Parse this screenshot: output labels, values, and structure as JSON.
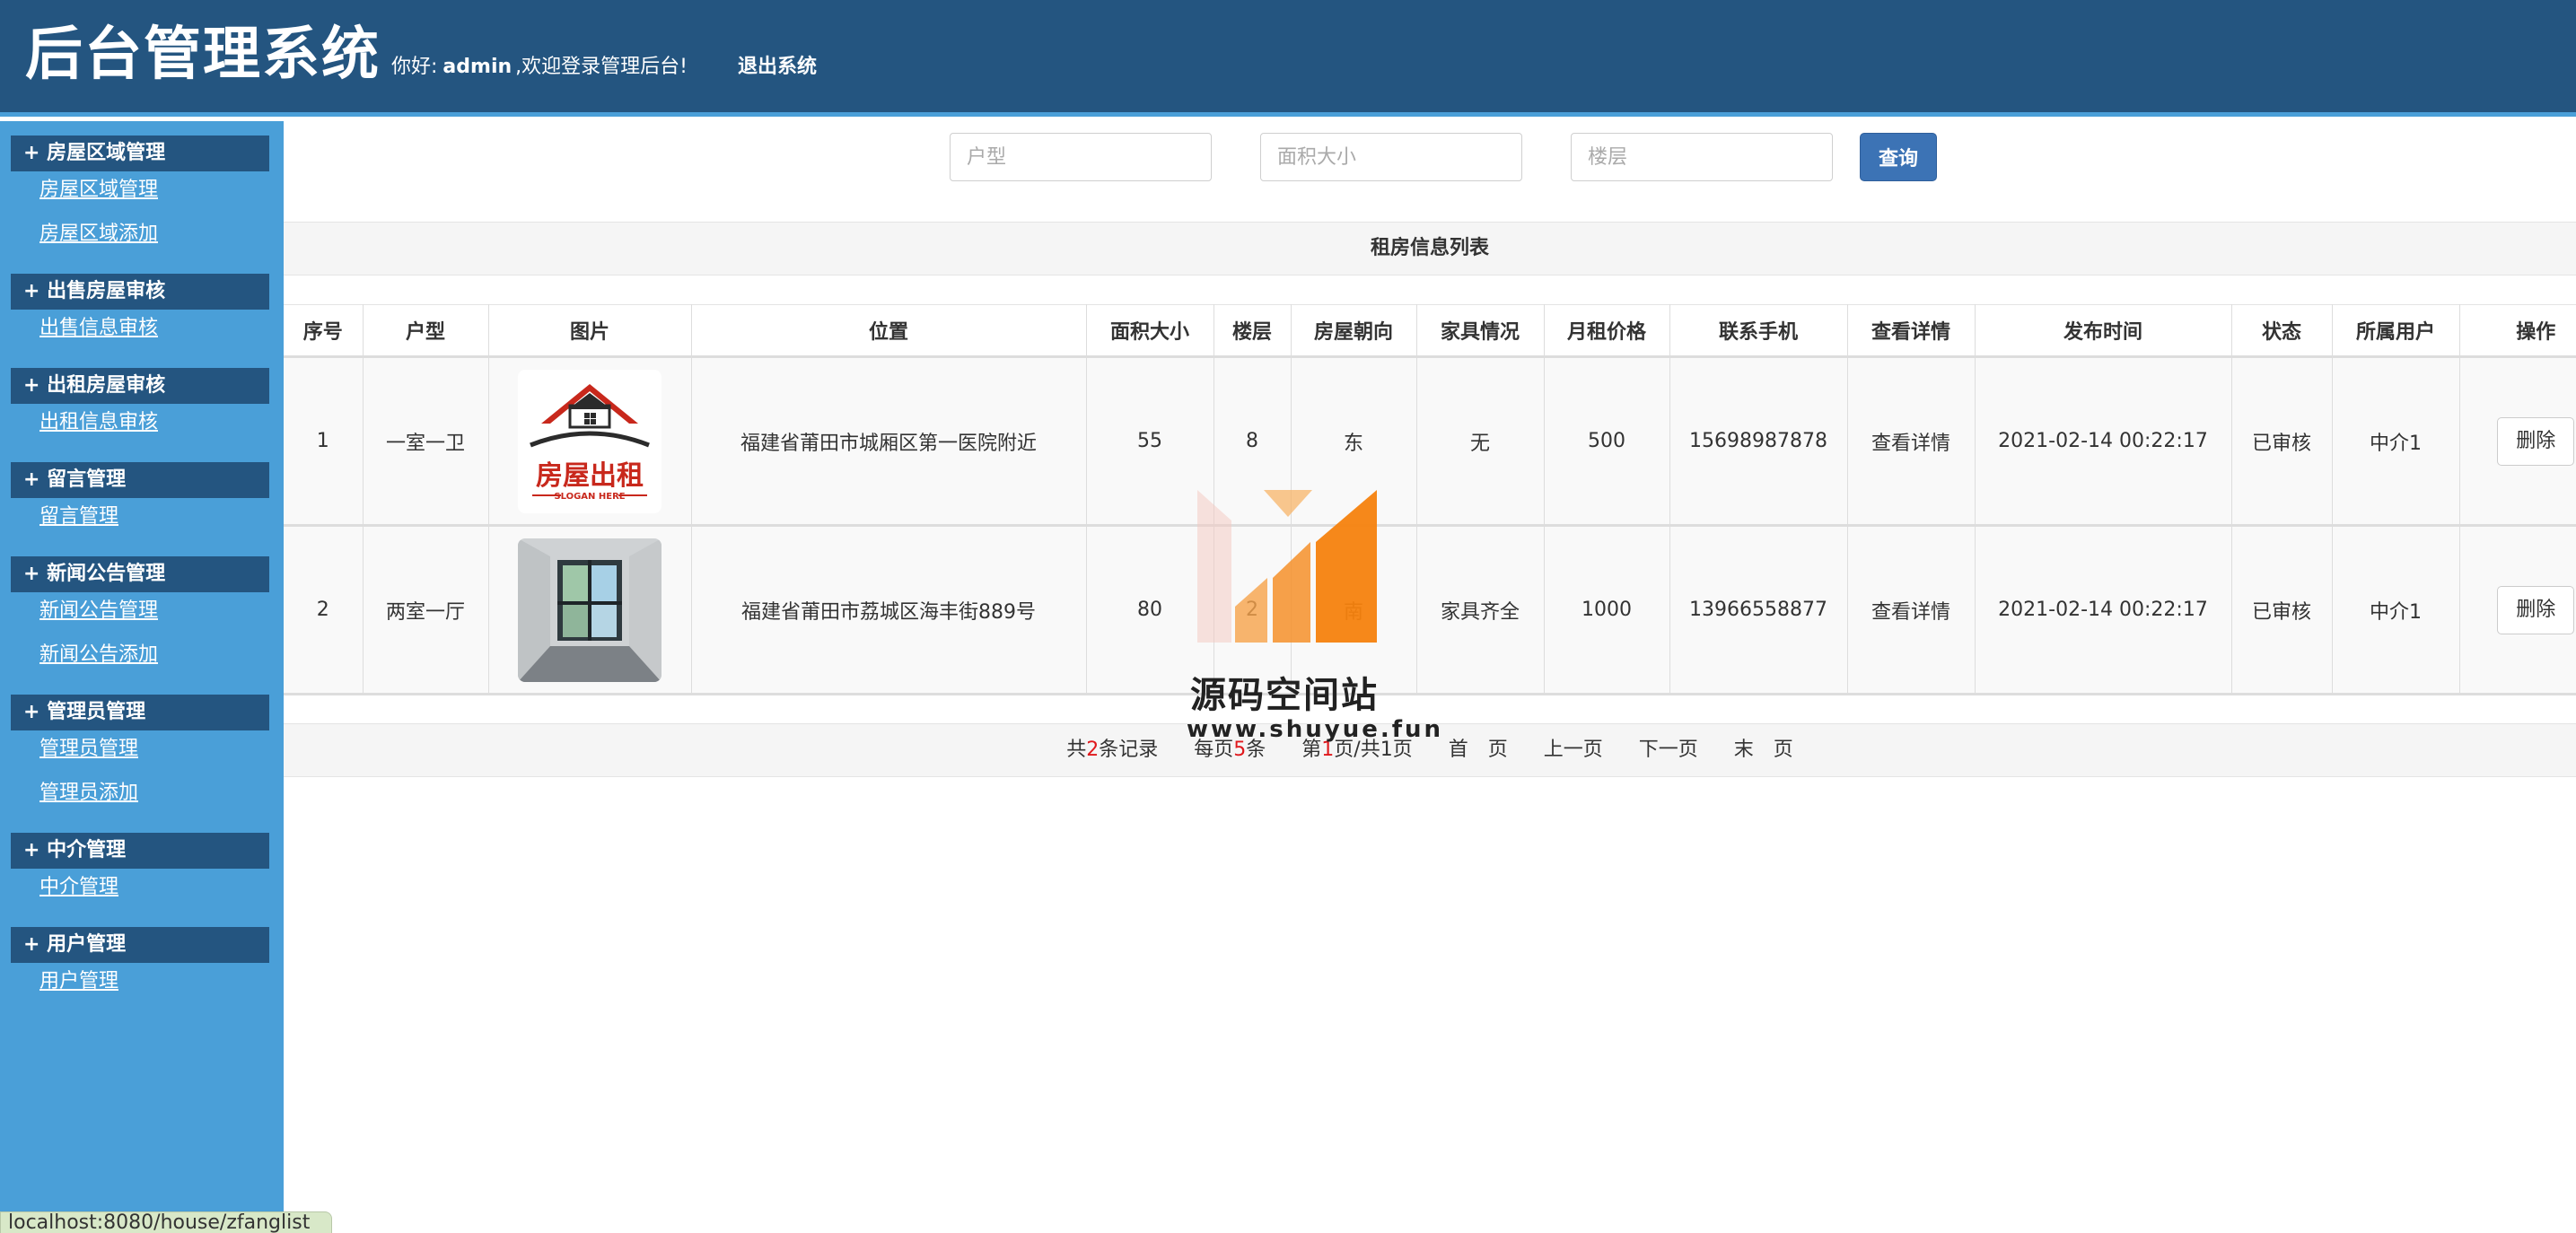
{
  "header": {
    "title": "后台管理系统",
    "greeting_prefix": "你好:",
    "username": "admin",
    "greeting_suffix": ",欢迎登录管理后台!",
    "logout_label": "退出系统"
  },
  "sidebar": {
    "groups": [
      {
        "title": "+ 房屋区域管理",
        "links": [
          "房屋区域管理",
          "房屋区域添加"
        ]
      },
      {
        "title": "+ 出售房屋审核",
        "links": [
          "出售信息审核"
        ]
      },
      {
        "title": "+ 出租房屋审核",
        "links": [
          "出租信息审核"
        ]
      },
      {
        "title": "+ 留言管理",
        "links": [
          "留言管理"
        ]
      },
      {
        "title": "+ 新闻公告管理",
        "links": [
          "新闻公告管理",
          "新闻公告添加"
        ]
      },
      {
        "title": "+ 管理员管理",
        "links": [
          "管理员管理",
          "管理员添加"
        ]
      },
      {
        "title": "+ 中介管理",
        "links": [
          "中介管理"
        ]
      },
      {
        "title": "+ 用户管理",
        "links": [
          "用户管理"
        ]
      }
    ]
  },
  "search": {
    "layout_placeholder": "户型",
    "area_placeholder": "面积大小",
    "floor_placeholder": "楼层",
    "submit_label": "查询"
  },
  "table": {
    "caption": "租房信息列表",
    "columns": [
      "序号",
      "户型",
      "图片",
      "位置",
      "面积大小",
      "楼层",
      "房屋朝向",
      "家具情况",
      "月租价格",
      "联系手机",
      "查看详情",
      "发布时间",
      "状态",
      "所属用户",
      "操作"
    ],
    "rows": [
      {
        "index": "1",
        "layout": "一室一卫",
        "image": "rent-sign-logo-image",
        "location": "福建省莆田市城厢区第一医院附近",
        "area": "55",
        "floor": "8",
        "orientation": "东",
        "furniture": "无",
        "price": "500",
        "phone": "15698987878",
        "detail": "查看详情",
        "time": "2021-02-14 00:22:17",
        "status": "已审核",
        "owner": "中介1",
        "action": "删除"
      },
      {
        "index": "2",
        "layout": "两室一厅",
        "image": "empty-room-photo",
        "location": "福建省莆田市荔城区海丰街889号",
        "area": "80",
        "floor": "2",
        "orientation": "南",
        "furniture": "家具齐全",
        "price": "1000",
        "phone": "13966558877",
        "detail": "查看详情",
        "time": "2021-02-14 00:22:17",
        "status": "已审核",
        "owner": "中介1",
        "action": "删除"
      }
    ],
    "logo_text": "房屋出租",
    "logo_slogan": "SLOGAN HERE"
  },
  "pager": {
    "total_prefix": "共",
    "total": "2",
    "total_suffix": "条记录",
    "per_page_prefix": "每页",
    "per_page": "5",
    "per_page_suffix": "条",
    "page_prefix": "第",
    "page": "1",
    "page_suffix": "页/共1页",
    "first": "首　页",
    "prev": "上一页",
    "next": "下一页",
    "last": "末　页"
  },
  "watermark": {
    "text": "源码空间站",
    "url": "www.shuyue.fun"
  },
  "status_bar": {
    "url": "localhost:8080/house/zfanglist"
  },
  "colors": {
    "header_bg": "#245580",
    "sidebar_bg": "#4a9fd8",
    "accent": "#3c73b5",
    "highlight": "#e0181c"
  }
}
